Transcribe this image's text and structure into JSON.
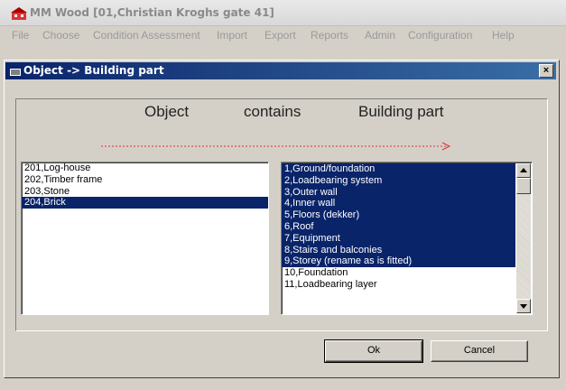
{
  "app": {
    "title": "MM Wood  [01,Christian Kroghs gate 41]"
  },
  "menu": [
    "File",
    "Choose",
    "Condition Assessment",
    "Import",
    "Export",
    "Reports",
    "Admin",
    "Configuration",
    "Help"
  ],
  "dialog": {
    "title": "Object -> Building part",
    "close_label": "×",
    "headings": {
      "left": "Object",
      "middle": "contains",
      "right": "Building part"
    },
    "objects": [
      {
        "label": "201,Log-house",
        "selected": false
      },
      {
        "label": "202,Timber frame",
        "selected": false
      },
      {
        "label": "203,Stone",
        "selected": false
      },
      {
        "label": "204,Brick",
        "selected": true
      }
    ],
    "building_parts": [
      {
        "label": "1,Ground/foundation",
        "selected": true
      },
      {
        "label": "2,Loadbearing system",
        "selected": true
      },
      {
        "label": "3,Outer wall",
        "selected": true
      },
      {
        "label": "4,Inner wall",
        "selected": true
      },
      {
        "label": "5,Floors (dekker)",
        "selected": true
      },
      {
        "label": "6,Roof",
        "selected": true
      },
      {
        "label": "7,Equipment",
        "selected": true
      },
      {
        "label": "8,Stairs and balconies",
        "selected": true
      },
      {
        "label": "9,Storey (rename as is fitted)",
        "selected": true
      },
      {
        "label": "10,Foundation",
        "selected": false
      },
      {
        "label": "11,Loadbearing layer",
        "selected": false
      }
    ],
    "ok_label": "Ok",
    "cancel_label": "Cancel"
  },
  "colors": {
    "selection": "#0a246a",
    "arrow": "#e03030",
    "dialog_face": "#d4d0c8"
  }
}
